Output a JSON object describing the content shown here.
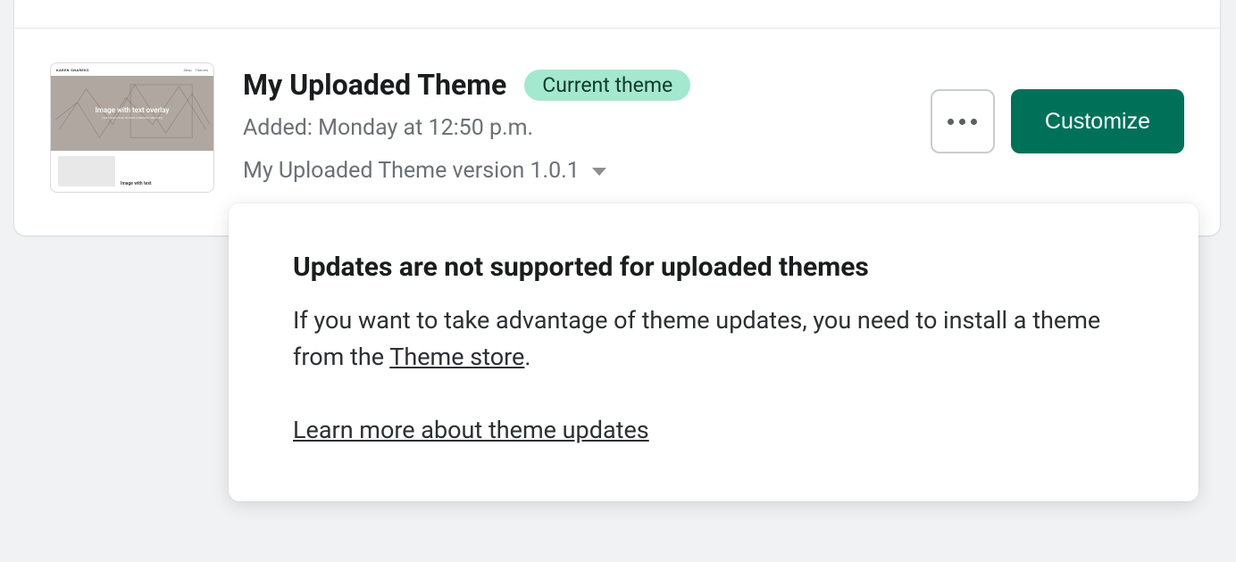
{
  "theme": {
    "title": "My Uploaded Theme",
    "badge": "Current theme",
    "added_line": "Added: Monday at 12:50 p.m.",
    "version_line": "My Uploaded Theme version 1.0.1",
    "customize_label": "Customize"
  },
  "thumbnail": {
    "brand": "KAREN SNAREKS",
    "nav1": "Shop",
    "nav2": "Themes",
    "hero_text": "Image with text overlay",
    "hero_sub": "Lorem ipsum dolor sit amet consectetur adipiscing",
    "lower_label": "Image with text"
  },
  "popover": {
    "title": "Updates are not supported for uploaded themes",
    "body_prefix": "If you want to take advantage of theme updates, you need to install a theme from the ",
    "theme_store_link": "Theme store",
    "body_suffix": ".",
    "learn_more": "Learn more about theme updates"
  }
}
